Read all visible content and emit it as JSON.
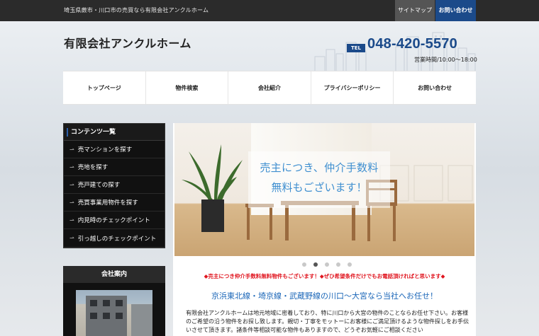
{
  "topbar": {
    "tagline": "埼玉県蕨市・川口市の売買なら有限会社アンクルホーム",
    "sitemap_label": "サイトマップ",
    "contact_label": "お問い合わせ"
  },
  "header": {
    "logo": "有限会社アンクルホーム",
    "tel_badge": "TEL",
    "tel_number": "048-420-5570",
    "hours": "営業時間/10:00～18:00"
  },
  "nav": {
    "items": [
      {
        "label": "トップページ"
      },
      {
        "label": "物件検索"
      },
      {
        "label": "会社紹介"
      },
      {
        "label": "プライバシーポリシー"
      },
      {
        "label": "お問い合わせ"
      }
    ]
  },
  "sidebar": {
    "heading": "コンテンツ一覧",
    "items": [
      {
        "label": "売マンションを探す"
      },
      {
        "label": "売地を探す"
      },
      {
        "label": "売戸建ての探す"
      },
      {
        "label": "売買事業用物件を探す"
      },
      {
        "label": "内見時のチェックポイント"
      },
      {
        "label": "引っ越しのチェックポイント"
      }
    ],
    "arrow_glyph": "⇀",
    "company_heading": "会社案内"
  },
  "slider": {
    "line1": "売主につき、仲介手数料",
    "line2": "無料もございます！",
    "dot_count": 5,
    "active_dot": 1
  },
  "main": {
    "notice": "◆売主につき仲介手数料無料物件もございます！◆ぜひ希望条件だけでもお電話頂ければと思います◆",
    "subheading": "京浜東北線・埼京線・武蔵野線の川口〜大宮なら当社へお任せ！",
    "body": "有限会社アンクルホームは地元地域に密着しており、特に川口から大宮の物件のことならお任せ下さい。お客様のご希望の沿う物件をお探し致します。親切・丁寧をモットーにお客様にご満足頂けるような物件探しをお手伝いさせて頂きます。諸条件等相談可能な物件もありますので、どうぞお気軽にご相談ください"
  },
  "colors": {
    "brand_blue": "#1b4a8a",
    "accent_red": "#e0141e",
    "slide_text_blue": "#3f8fd0"
  }
}
